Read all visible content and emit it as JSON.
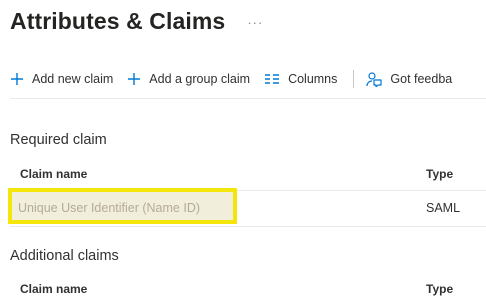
{
  "header": {
    "title": "Attributes & Claims",
    "more": "···"
  },
  "toolbar": {
    "add_claim": "Add new claim",
    "add_group_claim": "Add a group claim",
    "columns": "Columns",
    "feedback": "Got feedba"
  },
  "required": {
    "section_title": "Required claim",
    "col_name": "Claim name",
    "col_type": "Type",
    "rows": [
      {
        "name": "Unique User Identifier (Name ID)",
        "type": "SAML"
      }
    ]
  },
  "additional": {
    "section_title": "Additional claims",
    "col_name": "Claim name",
    "col_type": "Type"
  },
  "colors": {
    "accent": "#0078d4",
    "highlight_border": "#f4e60a"
  }
}
